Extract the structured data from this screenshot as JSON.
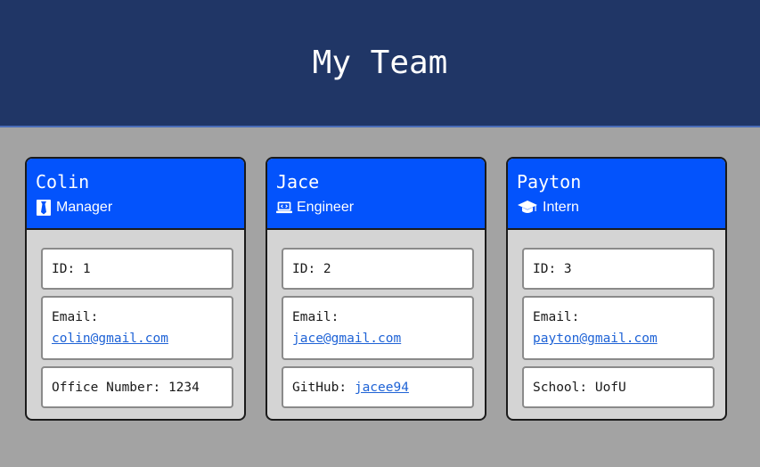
{
  "header": {
    "title": "My Team"
  },
  "colors": {
    "header_bg": "#203666",
    "card_head_bg": "#0353fc",
    "page_bg": "#a3a3a3",
    "card_body_bg": "#d4d4d4",
    "link": "#1f63d6"
  },
  "cards": [
    {
      "name": "Colin",
      "role": "Manager",
      "role_icon": "tie-icon",
      "id_label": "ID: 1",
      "email_label": "Email:",
      "email": "colin@gmail.com",
      "extra_label": "Office Number: 1234",
      "extra_link": ""
    },
    {
      "name": "Jace",
      "role": "Engineer",
      "role_icon": "laptop-code-icon",
      "id_label": "ID: 2",
      "email_label": "Email:",
      "email": "jace@gmail.com",
      "extra_label": "GitHub: ",
      "extra_link": "jacee94"
    },
    {
      "name": "Payton",
      "role": "Intern",
      "role_icon": "graduation-cap-icon",
      "id_label": "ID: 3",
      "email_label": "Email:",
      "email": "payton@gmail.com",
      "extra_label": "School: UofU",
      "extra_link": ""
    }
  ]
}
